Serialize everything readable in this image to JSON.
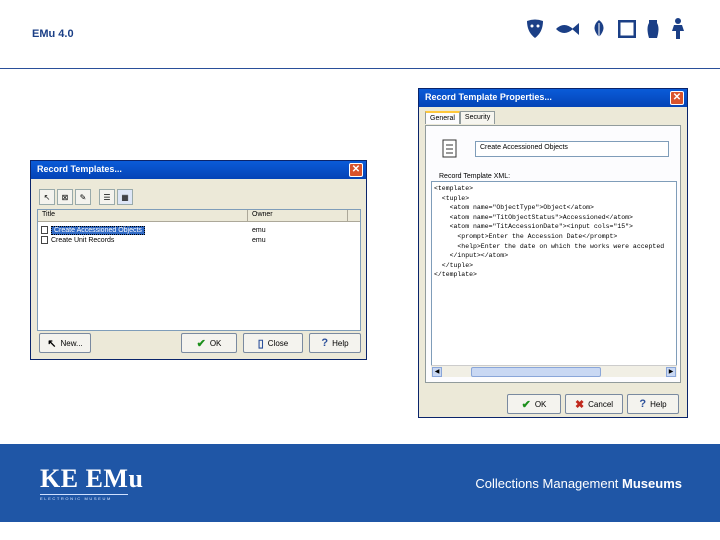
{
  "header": {
    "title": "EMu 4.0"
  },
  "header_icons": [
    "mask-icon",
    "fish-icon",
    "leaf-icon",
    "frame-icon",
    "vase-icon",
    "figure-icon"
  ],
  "footer": {
    "logo_text": "KE EMu",
    "logo_sub": "ELECTRONIC MUSEUM",
    "tagline_prefix": "Collections Management",
    "tagline_bold": "Museums"
  },
  "record_templates": {
    "title": "Record Templates...",
    "columns": [
      "Title",
      "Owner"
    ],
    "rows": [
      {
        "title": "Create Accessioned Objects",
        "owner": "emu",
        "selected": true
      },
      {
        "title": "Create Unit Records",
        "owner": "emu",
        "selected": false
      }
    ],
    "buttons": {
      "new": "New...",
      "ok": "OK",
      "close": "Close",
      "help": "Help"
    }
  },
  "template_properties": {
    "title": "Record Template Properties...",
    "tabs": [
      "General",
      "Security"
    ],
    "name_value": "Create Accessioned Objects",
    "xml_label": "Record Template XML:",
    "xml_lines": [
      "<template>",
      "  <tuple>",
      "    <atom name=\"ObjectType\">Object</atom>",
      "    <atom name=\"TitObjectStatus\">Accessioned</atom>",
      "    <atom name=\"TitAccessionDate\"><input cols=\"15\">",
      "      <prompt>Enter the Accession Date</prompt>",
      "      <help>Enter the date on which the works were accepted",
      "    </input></atom>",
      "  </tuple>",
      "</template>"
    ],
    "buttons": {
      "ok": "OK",
      "cancel": "Cancel",
      "help": "Help"
    }
  },
  "colors": {
    "footer_bg": "#1f56a6",
    "accent": "#1b3f86"
  }
}
